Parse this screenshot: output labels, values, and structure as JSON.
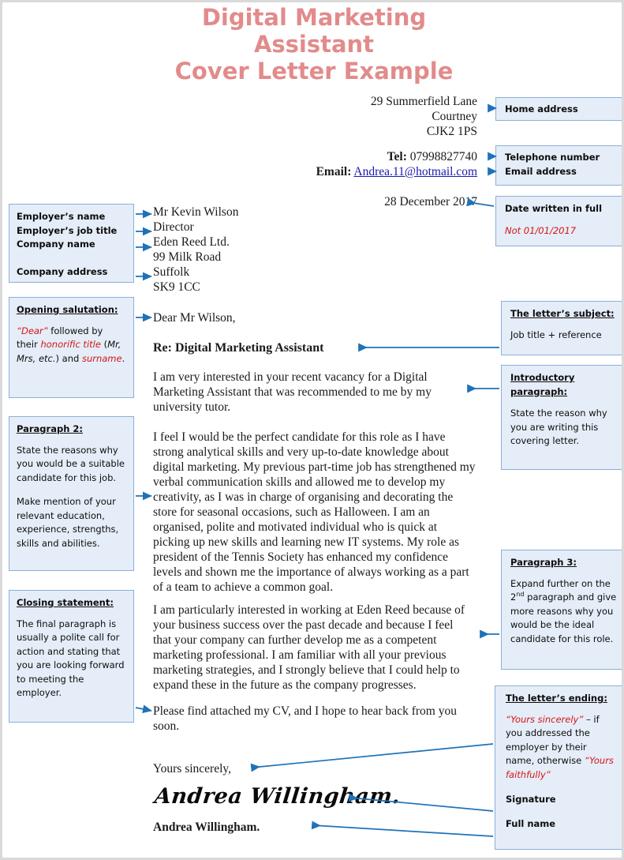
{
  "title": {
    "line1": "Digital Marketing",
    "line2": "Assistant",
    "line3": "Cover Letter Example",
    "color": "#e28b8b"
  },
  "letter": {
    "home_address": {
      "line1": "29 Summerfield Lane",
      "line2": "Courtney",
      "line3": "CJK2 1PS"
    },
    "contact": {
      "tel_label": "Tel:",
      "tel_value": "07998827740",
      "email_label": "Email:",
      "email_value": "Andrea.11@hotmail.com"
    },
    "date": "28 December 2017",
    "recipient": {
      "name": "Mr Kevin Wilson",
      "job_title": "Director",
      "company": "Eden Reed Ltd.",
      "street": "99 Milk Road",
      "county": "Suffolk",
      "postcode": "SK9 1CC"
    },
    "salutation": "Dear Mr Wilson,",
    "subject": "Re: Digital Marketing Assistant",
    "paragraph1": "I am very interested in your recent vacancy for a Digital Marketing Assistant that was recommended to me by my university tutor.",
    "paragraph2": "I feel I would be the perfect candidate for this role as I have strong analytical skills and very up-to-date knowledge about digital marketing. My previous part-time job has strengthened my verbal communication skills and allowed me to develop my creativity, as I was in charge of organising and decorating the store for seasonal occasions, such as Halloween. I am an organised, polite and motivated individual who is quick at picking up new skills and learning new IT systems. My role as president of the Tennis Society has enhanced my confidence levels and shown me the importance of always working as a part of a team to achieve a common goal.",
    "paragraph3": "I am particularly interested in working at Eden Reed because of your business success over the past decade and because I feel that your company can further develop me as a competent marketing professional. I am familiar with all your previous marketing strategies, and I strongly believe that I could help to expand these in the future as the company progresses.",
    "paragraph4": "Please find attached my CV, and I hope to hear back from you soon.",
    "sign_off": "Yours sincerely,",
    "signature": "Andrea Willingham.",
    "full_name": "Andrea Willingham."
  },
  "notes": {
    "home_address": {
      "label": "Home address"
    },
    "telephone": {
      "label": "Telephone number"
    },
    "email": {
      "label": "Email address"
    },
    "date": {
      "heading": "Date written in full",
      "warning": "Not 01/01/2017"
    },
    "employer": {
      "line1": "Employer’s name",
      "line2": "Employer’s job title",
      "line3": "Company name",
      "line4": "Company address"
    },
    "salutation": {
      "heading": "Opening salutation:",
      "t1": "“Dear”",
      "t2": " followed by their ",
      "t3": "honorific title",
      "t4": " (",
      "t5": "Mr, Mrs, etc.",
      "t6": ") and ",
      "t7": "surname",
      "t8": "."
    },
    "paragraph2": {
      "heading": "Paragraph 2:",
      "body1": "State the reasons why you would be a suitable candidate for this job.",
      "body2": "Make mention of your relevant education, experience, strengths, skills and abilities."
    },
    "closing": {
      "heading": "Closing statement:",
      "body": "The final paragraph is usually a polite call for action and stating that you are looking forward to meeting the employer."
    },
    "subject": {
      "heading": "The letter’s subject:",
      "body": "Job title + reference"
    },
    "intro": {
      "heading_line1": "Introductory",
      "heading_line2": "paragraph:",
      "body": "State the reason why you are writing this covering letter."
    },
    "paragraph3": {
      "heading": "Paragraph 3:",
      "body_a": "Expand further on the 2",
      "body_sup": "nd",
      "body_b": " paragraph and give more reasons why you would be the ideal candidate for this role."
    },
    "ending": {
      "heading": "The letter’s ending:",
      "q1": "“Yours sincerely”",
      "mid": " – if you addressed the employer by their name, otherwise ",
      "q2": "“Yours faithfully”",
      "signature_label": "Signature",
      "fullname_label": "Full name"
    }
  },
  "colors": {
    "note_fill": "#e5edf8",
    "note_border": "#8bb0d8",
    "arrow": "#1f72b8",
    "red": "#d41616",
    "link": "#1a1ab0"
  }
}
